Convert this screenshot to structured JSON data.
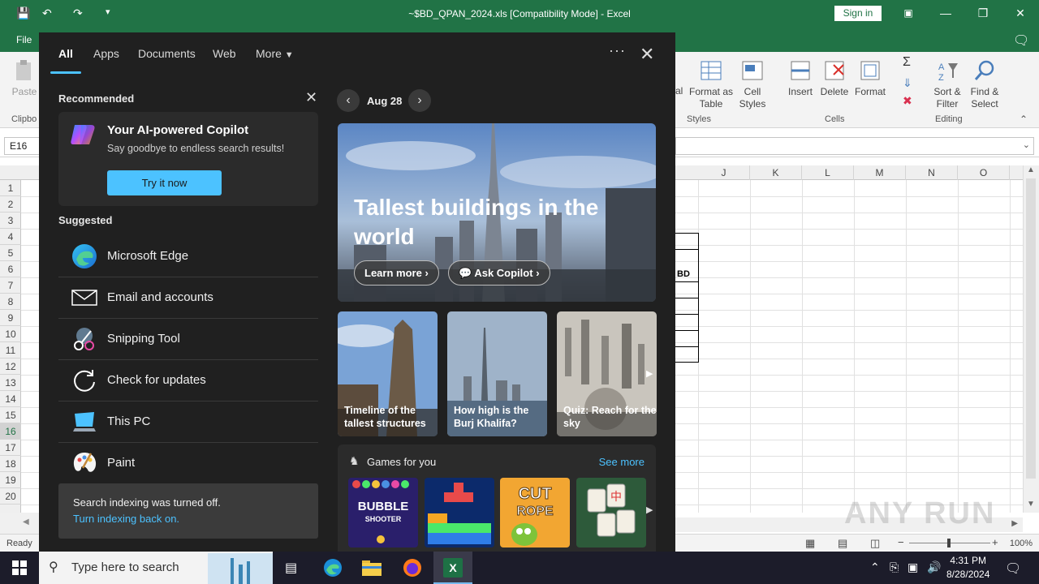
{
  "excel": {
    "title": "~$BD_QPAN_2024.xls  [Compatibility Mode]  -  Excel",
    "sign_in": "Sign in",
    "file_tab": "File",
    "namebox": "E16",
    "ribbon": {
      "paste": "Paste",
      "clipboard": "Clipbo",
      "format_as_table": "Format as Table",
      "cell_styles": "Cell Styles",
      "styles_group": "Styles",
      "insert": "Insert",
      "delete": "Delete",
      "format": "Format",
      "cells_group": "Cells",
      "sort_filter": "Sort & Filter",
      "find_select": "Find & Select",
      "editing_group": "Editing",
      "al": "al"
    },
    "columns": [
      "J",
      "K",
      "L",
      "M",
      "N",
      "O"
    ],
    "rows": [
      "1",
      "2",
      "3",
      "4",
      "5",
      "6",
      "7",
      "8",
      "9",
      "10",
      "11",
      "12",
      "13",
      "14",
      "15",
      "16",
      "17",
      "18",
      "19",
      "20"
    ],
    "selected_row": "16",
    "cell_bd": "BD",
    "status_ready": "Ready",
    "zoom": "100%"
  },
  "search": {
    "tabs": [
      "All",
      "Apps",
      "Documents",
      "Web",
      "More"
    ],
    "recommended_title": "Recommended",
    "copilot_title": "Your AI-powered Copilot",
    "copilot_sub": "Say goodbye to endless search results!",
    "try_button": "Try it now",
    "suggested_title": "Suggested",
    "suggested": [
      "Microsoft Edge",
      "Email and accounts",
      "Snipping Tool",
      "Check for updates",
      "This PC",
      "Paint"
    ],
    "index_line1": "Search indexing was turned off.",
    "index_line2": "Turn indexing back on.",
    "date": "Aug 28",
    "hero_title": "Tallest buildings in the world",
    "learn_more": "Learn more",
    "ask_copilot": "Ask Copilot",
    "cards": [
      "Timeline of the tallest structures",
      "How high is the Burj Khalifa?",
      "Quiz: Reach for the sky"
    ],
    "games_title": "Games for you",
    "see_more": "See more",
    "games": [
      "Bubble Shooter",
      "Blocks",
      "Cut the Rope",
      "Mahjong"
    ]
  },
  "taskbar": {
    "search_placeholder": "Type here to search",
    "time": "4:31 PM",
    "date": "8/28/2024"
  },
  "watermark": "ANY RUN",
  "colors": {
    "excel_green": "#217346",
    "accent_blue": "#4cc2ff",
    "panel_bg": "#202020"
  }
}
